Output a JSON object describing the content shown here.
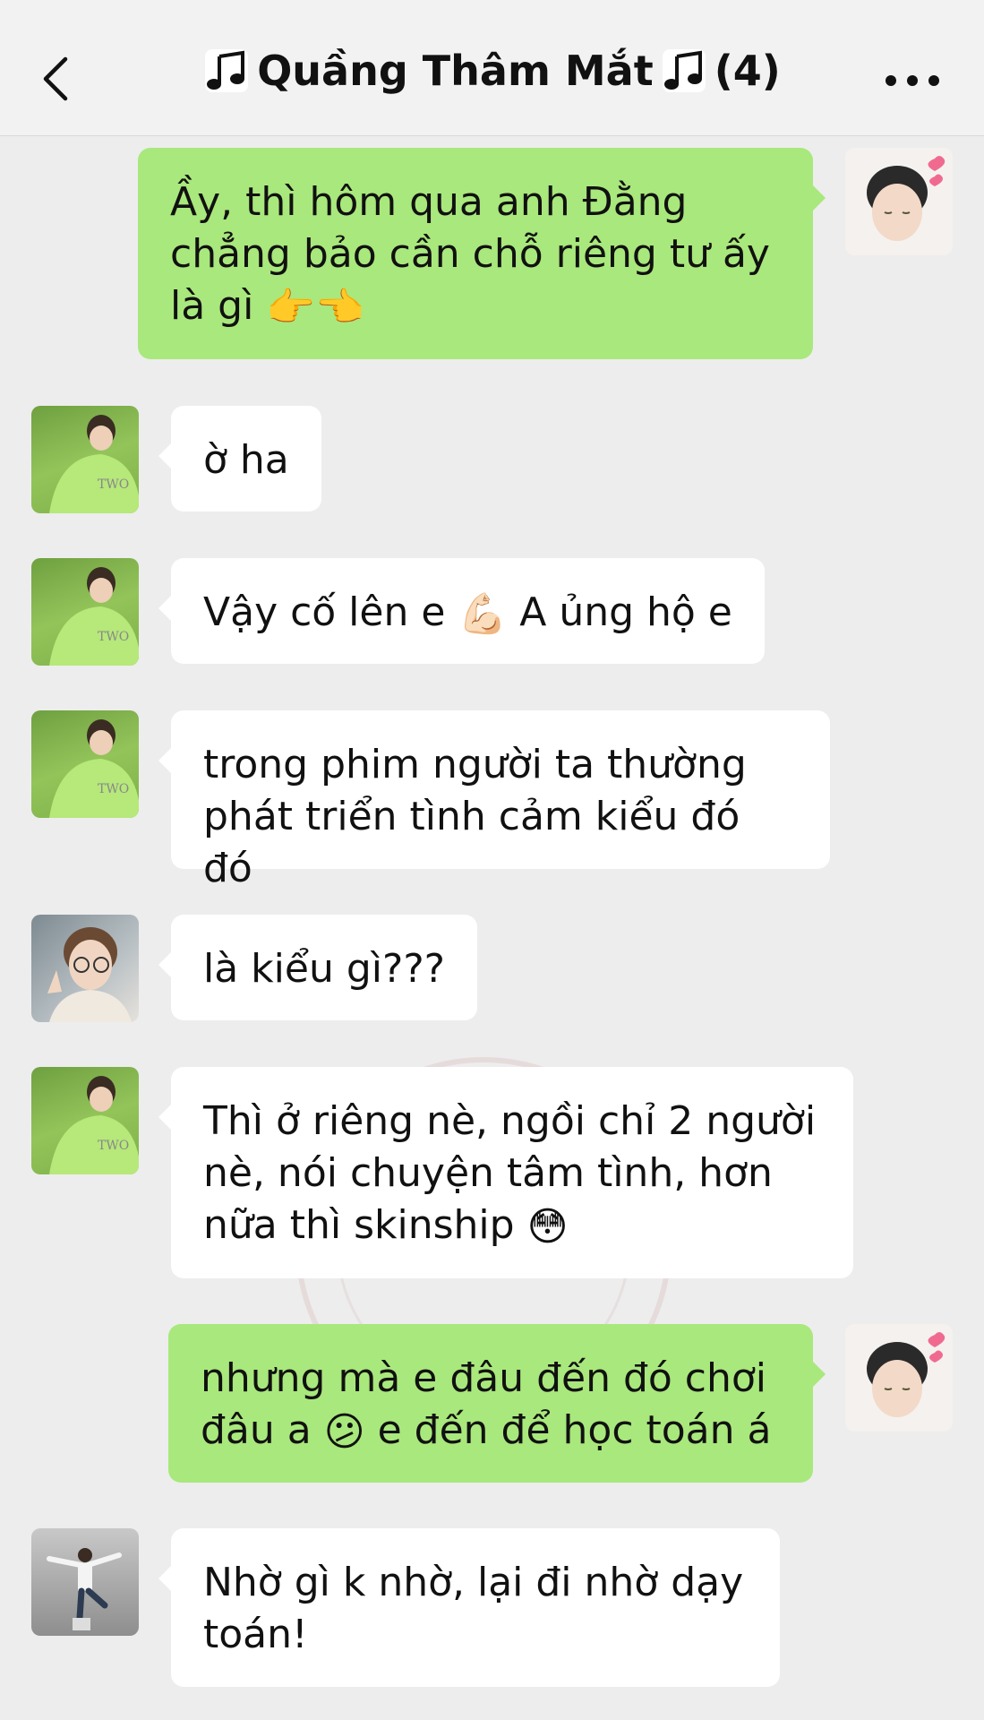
{
  "header": {
    "title": "Quầng Thâm Mắt",
    "member_count": "(4)"
  },
  "messages": [
    {
      "side": "out",
      "avatar": "avatar-self",
      "text": "Ầy, thì hôm qua anh Đằng chẳng bảo cần chỗ riêng tư ấy là gì",
      "emoji": "👉👈"
    },
    {
      "side": "in",
      "avatar": "avatar-green-shirt",
      "text": "ờ ha"
    },
    {
      "side": "in",
      "avatar": "avatar-green-shirt",
      "text": "Vậy cố lên e",
      "emoji": "💪🏻",
      "text_after": "A ủng hộ e"
    },
    {
      "side": "in",
      "avatar": "avatar-green-shirt",
      "text": "trong phim người ta thường phát triển tình cảm kiểu đó đó"
    },
    {
      "side": "in",
      "avatar": "avatar-glasses",
      "text": "là kiểu gì???"
    },
    {
      "side": "in",
      "avatar": "avatar-green-shirt",
      "text": "Thì ở riêng nè, ngồi chỉ 2 người nè, nói chuyện tâm tình, hơn nữa thì skinship",
      "emoji": "😳"
    },
    {
      "side": "out",
      "avatar": "avatar-self",
      "text": "nhưng mà e đâu đến đó chơi đâu a",
      "emoji": "😕",
      "text_after": "e đến để học toán á"
    },
    {
      "side": "in",
      "avatar": "avatar-standing",
      "text": "Nhờ gì k nhờ, lại đi nhờ dạy toán!"
    }
  ]
}
